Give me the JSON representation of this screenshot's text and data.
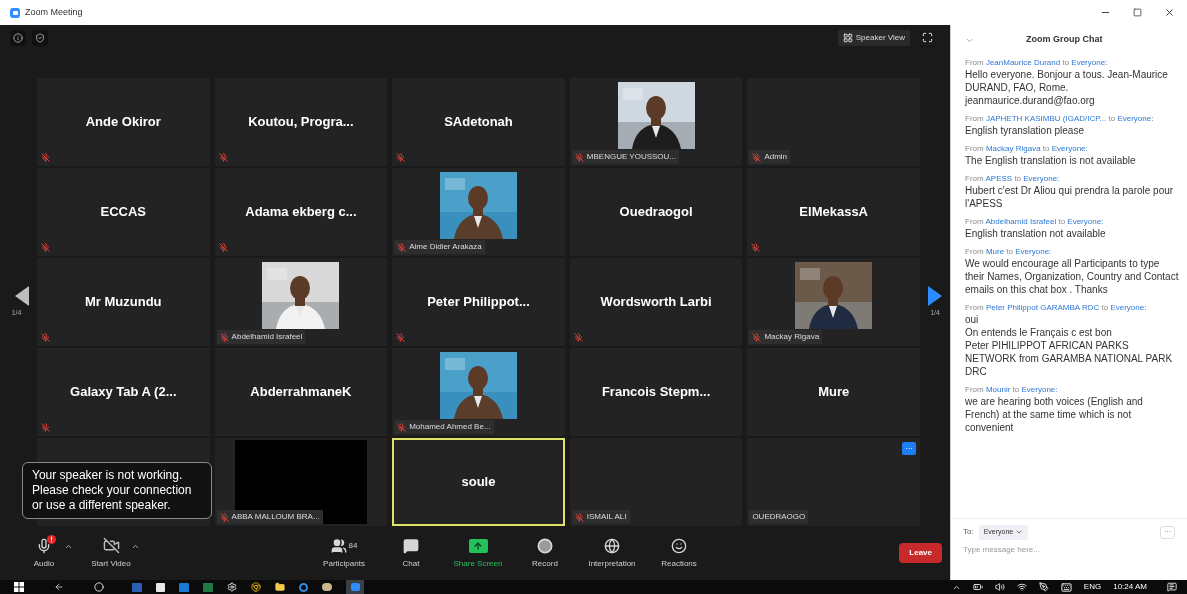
{
  "window": {
    "title": "Zoom Meeting"
  },
  "video": {
    "view_button": "Speaker View",
    "page_left": "1/4",
    "page_right": "1/4",
    "tiles": [
      {
        "kind": "name",
        "name": "Ande Okiror",
        "muted": true,
        "active": false
      },
      {
        "kind": "name",
        "name": "Koutou, Progra...",
        "muted": true,
        "active": false
      },
      {
        "kind": "name",
        "name": "SAdetonah",
        "muted": true,
        "active": false
      },
      {
        "name": "MBENGUE YOUSSOU...",
        "muted": true,
        "active": false
      },
      {
        "kind": "label",
        "name": "Admin",
        "muted": true,
        "active": false
      },
      {
        "kind": "name",
        "name": "ECCAS",
        "muted": true,
        "active": false
      },
      {
        "kind": "name",
        "name": "Adama ekberg c...",
        "muted": true,
        "active": false
      },
      {
        "name": "Aime Didier Arakaza",
        "muted": true,
        "active": false
      },
      {
        "kind": "name",
        "name": "Ouedraogol",
        "muted": false,
        "active": false
      },
      {
        "kind": "name",
        "name": "ElMekassA",
        "muted": true,
        "active": false
      },
      {
        "kind": "name",
        "name": "Mr Muzundu",
        "muted": true,
        "active": false
      },
      {
        "name": "Abdelhamid Israfeel",
        "muted": true,
        "active": false
      },
      {
        "kind": "name",
        "name": "Peter  Philippot...",
        "muted": true,
        "active": false
      },
      {
        "kind": "name",
        "name": "Wordsworth Larbi",
        "muted": true,
        "active": false
      },
      {
        "name": "Mackay Rigava",
        "muted": true,
        "active": false
      },
      {
        "kind": "name",
        "name": "Galaxy Tab A (2...",
        "muted": true,
        "active": false
      },
      {
        "kind": "name",
        "name": "AbderrahmaneK",
        "muted": false,
        "active": false
      },
      {
        "name": "Mohamed Ahmed Be...",
        "muted": true,
        "active": false
      },
      {
        "kind": "name",
        "name": "Francois Stepm...",
        "muted": false,
        "active": false
      },
      {
        "kind": "name",
        "name": "Mure",
        "muted": false,
        "active": false
      },
      {
        "kind": "blank",
        "active": false
      },
      {
        "kind": "video",
        "name": "ABBA MALLOUM BRA...",
        "muted": true,
        "active": false
      },
      {
        "kind": "name",
        "name": "soule",
        "muted": false,
        "active": true
      },
      {
        "kind": "label",
        "name": "ISMAIL ALI",
        "muted": true,
        "active": false
      },
      {
        "kind": "label",
        "name": "OUEDRAOGO",
        "muted": false,
        "active": false,
        "more": "···"
      }
    ]
  },
  "toast": {
    "text": "Your speaker is not working. Please check your connection or use a different speaker."
  },
  "toolbar": {
    "left_items": [
      {
        "kind": "audio",
        "label": "Audio",
        "has_menu": true,
        "alert": true
      },
      {
        "kind": "video",
        "label": "Start Video",
        "has_menu": true
      }
    ],
    "center_items": [
      {
        "kind": "participants",
        "label": "Participants",
        "count": "84"
      },
      {
        "kind": "chat",
        "label": "Chat"
      },
      {
        "kind": "share",
        "label": "Share Screen"
      },
      {
        "kind": "record",
        "label": "Record"
      },
      {
        "kind": "interpretation",
        "label": "Interpretation"
      },
      {
        "kind": "reactions",
        "label": "Reactions"
      }
    ],
    "leave": "Leave"
  },
  "chat": {
    "title": "Zoom Group Chat",
    "messages": [
      {
        "from": "From",
        "sender": "JeanMaurice Durand",
        "to": "to",
        "recipient": "Everyone:",
        "lines": [
          "Hello everyone. Bonjour a tous. Jean-Maurice DURAND, FAO, Rome. jeanmaurice.durand@fao.org"
        ]
      },
      {
        "from": "From",
        "sender": "JAPHETH KASIMBU (IGAD/ICP...",
        "to": "to",
        "recipient": "Everyone:",
        "lines": [
          "English tyranslation please"
        ]
      },
      {
        "from": "From",
        "sender": "Mackay Rigava",
        "to": "to",
        "recipient": "Everyone:",
        "lines": [
          "The English translation is not available"
        ]
      },
      {
        "from": "From",
        "sender": "APESS",
        "to": "to",
        "recipient": "Everyone:",
        "lines": [
          "Hubert c'est Dr Aliou qui prendra la parole pour l'APESS"
        ]
      },
      {
        "from": "From",
        "sender": "Abdelhamid Israfeel",
        "to": "to",
        "recipient": "Everyone:",
        "lines": [
          "English translation not available"
        ]
      },
      {
        "from": "From",
        "sender": "Mure",
        "to": "to",
        "recipient": "Everyone:",
        "lines": [
          "We would encourage all Participants to type their Names, Organization, Country and Contact emails on this chat box . Thanks"
        ]
      },
      {
        "from": "From",
        "sender": "Peter Philippot GARAMBA RDC",
        "to": "to",
        "recipient": "Everyone:",
        "lines": [
          "oui",
          "On entends le Français c est bon",
          "Peter PIHILIPPOT  AFRICAN PARKS NETWORK from GARAMBA NATIONAL PARK DRC"
        ]
      },
      {
        "from": "From",
        "sender": "Mounir",
        "to": "to",
        "recipient": "Everyone:",
        "lines": [
          "we are hearing both voices (English and French) at the same time which is not convenient"
        ]
      }
    ],
    "to_label": "To:",
    "recipient_menu": "Everyone",
    "more": "···",
    "placeholder": "Type message here..."
  },
  "taskbar": {
    "language": "ENG",
    "time": "10:24 AM"
  }
}
